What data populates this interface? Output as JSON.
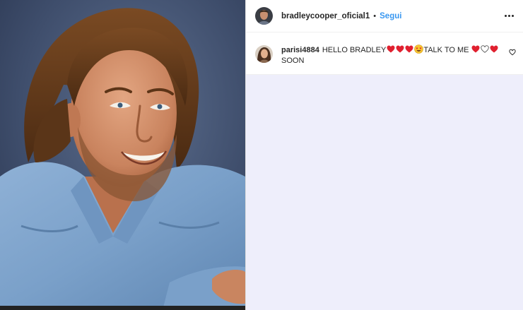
{
  "header": {
    "username": "bradleycooper_oficial1",
    "separator": "•",
    "follow_label": "Segui",
    "more_icon": "more-horizontal-icon"
  },
  "comment": {
    "username": "parisi4884",
    "text_part1": "HELLO BRADLEY",
    "text_part2": "TALK TO ME",
    "text_part3": "SOON",
    "emojis_after_part1": [
      "red-heart",
      "red-heart",
      "red-heart",
      "star-struck-face"
    ],
    "emojis_after_part2": [
      "red-heart",
      "white-heart",
      "red-heart"
    ],
    "like_icon": "heart-outline-icon"
  },
  "colors": {
    "follow_blue": "#3897f0",
    "text_dark": "#262626",
    "panel_background": "#eeeefb",
    "heart_red": "#e0202f"
  }
}
